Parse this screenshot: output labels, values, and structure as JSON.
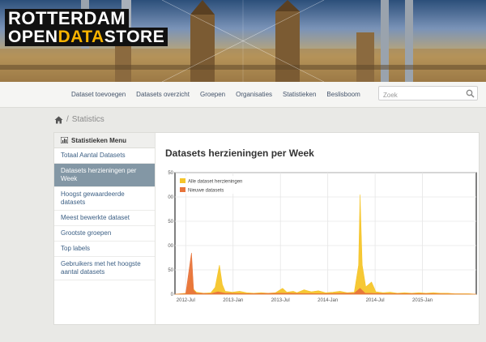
{
  "brand": {
    "line1": "ROTTERDAM",
    "line2_part1": "OPEN",
    "line2_part2": "DATA",
    "line2_part3": "STORE"
  },
  "nav": {
    "items": [
      "Dataset toevoegen",
      "Datasets overzicht",
      "Groepen",
      "Organisaties",
      "Statistieken",
      "Beslisboom"
    ]
  },
  "search": {
    "placeholder": "Zoek",
    "icon": "search-icon"
  },
  "breadcrumb": {
    "home_icon": "home-icon",
    "separator": "/",
    "current": "Statistics"
  },
  "menu": {
    "title": "Statistieken Menu",
    "title_icon": "bar-chart-icon",
    "items": [
      {
        "label": "Totaal Aantal Datasets",
        "active": false
      },
      {
        "label": "Datasets herzieningen per Week",
        "active": true
      },
      {
        "label": "Hoogst gewaardeerde datasets",
        "active": false
      },
      {
        "label": "Meest bewerkte dataset",
        "active": false
      },
      {
        "label": "Grootste groepen",
        "active": false
      },
      {
        "label": "Top labels",
        "active": false
      },
      {
        "label": "Gebruikers met het hoogste aantal datasets",
        "active": false
      }
    ]
  },
  "colors": {
    "accent": "#f7b300",
    "active_menu": "#8397a5",
    "series_all": "#f5c52a",
    "series_new": "#e8743b"
  },
  "chart_data": {
    "type": "area",
    "title": "Datasets herzieningen per Week",
    "xlabel": "",
    "ylabel": "",
    "x_ticks": [
      "2012-Jul",
      "2013-Jan",
      "2013-Jul",
      "2014-Jan",
      "2014-Jul",
      "2015-Jan"
    ],
    "ylim": [
      0,
      250
    ],
    "y_ticks": [
      0,
      50,
      100,
      150,
      200,
      250
    ],
    "grid": true,
    "legend": "top-left",
    "x_range_months": [
      0,
      42
    ],
    "series": [
      {
        "name": "Alle dataset herzieningen",
        "color": "#f5c52a",
        "points": [
          [
            0,
            0
          ],
          [
            1.5,
            2
          ],
          [
            2.3,
            45
          ],
          [
            2.6,
            10
          ],
          [
            3,
            4
          ],
          [
            4,
            2
          ],
          [
            5,
            3
          ],
          [
            5.6,
            14
          ],
          [
            6.2,
            60
          ],
          [
            6.6,
            20
          ],
          [
            7,
            6
          ],
          [
            8,
            4
          ],
          [
            9,
            6
          ],
          [
            10,
            3
          ],
          [
            11,
            2
          ],
          [
            12,
            3
          ],
          [
            13,
            2
          ],
          [
            14,
            3
          ],
          [
            15,
            12
          ],
          [
            15.6,
            4
          ],
          [
            16.5,
            6
          ],
          [
            17,
            3
          ],
          [
            18,
            9
          ],
          [
            19,
            5
          ],
          [
            20,
            7
          ],
          [
            21,
            3
          ],
          [
            22,
            4
          ],
          [
            23,
            6
          ],
          [
            24,
            3
          ],
          [
            25,
            4
          ],
          [
            25.6,
            60
          ],
          [
            25.8,
            205
          ],
          [
            26.1,
            60
          ],
          [
            26.6,
            15
          ],
          [
            27.4,
            25
          ],
          [
            28,
            5
          ],
          [
            29,
            3
          ],
          [
            30,
            4
          ],
          [
            31,
            2
          ],
          [
            32,
            3
          ],
          [
            33,
            2
          ],
          [
            34,
            3
          ],
          [
            35,
            2
          ],
          [
            36,
            3
          ],
          [
            37,
            2
          ],
          [
            38,
            2
          ],
          [
            39,
            1
          ],
          [
            40,
            1
          ],
          [
            41,
            1
          ],
          [
            42,
            0
          ]
        ]
      },
      {
        "name": "Nieuwe datasets",
        "color": "#e8743b",
        "points": [
          [
            0,
            0
          ],
          [
            1.5,
            1
          ],
          [
            2.3,
            85
          ],
          [
            2.6,
            8
          ],
          [
            3,
            2
          ],
          [
            5,
            1
          ],
          [
            6,
            5
          ],
          [
            7,
            2
          ],
          [
            10,
            1
          ],
          [
            15,
            2
          ],
          [
            20,
            1
          ],
          [
            25,
            2
          ],
          [
            25.8,
            12
          ],
          [
            26.5,
            2
          ],
          [
            30,
            1
          ],
          [
            35,
            1
          ],
          [
            42,
            0
          ]
        ]
      }
    ]
  }
}
